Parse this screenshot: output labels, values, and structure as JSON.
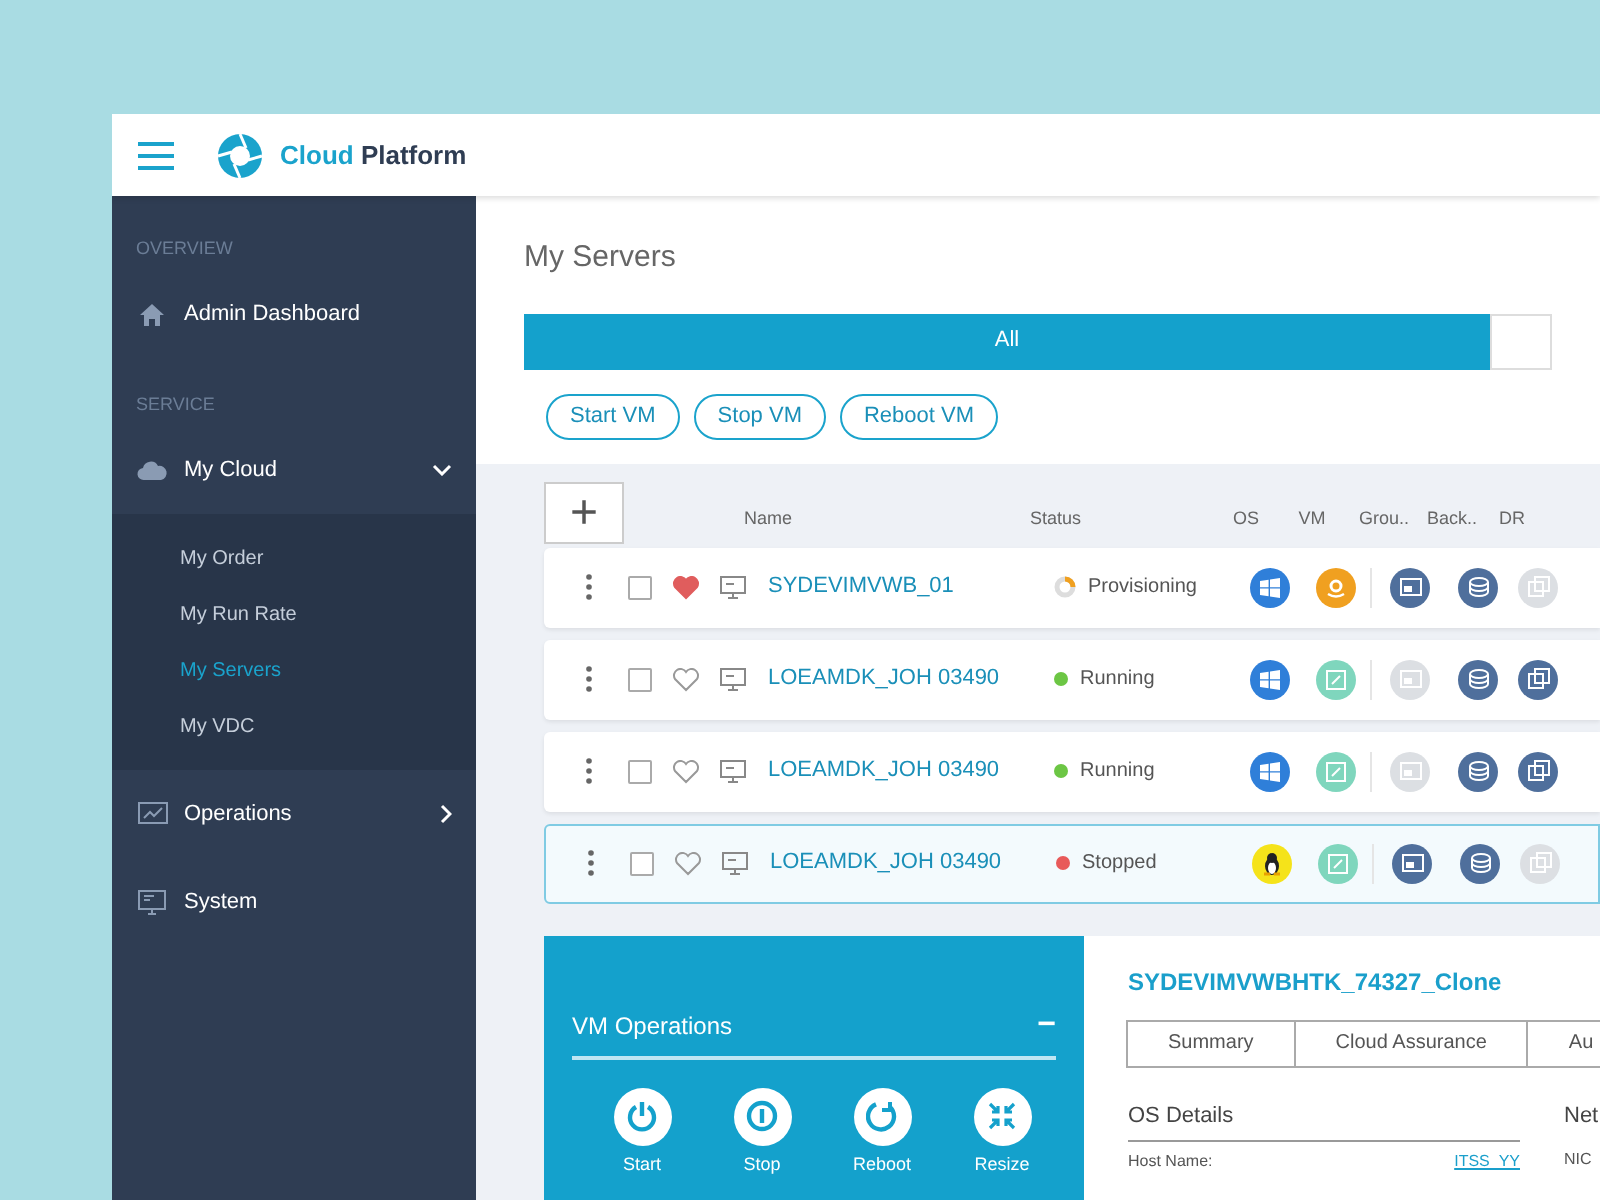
{
  "header": {
    "brand_first": "Cloud",
    "brand_second": "Platform"
  },
  "sidebar": {
    "sections": [
      {
        "heading": "OVERVIEW",
        "items": [
          {
            "label": "Admin Dashboard"
          }
        ]
      },
      {
        "heading": "SERVICE",
        "items": [
          {
            "label": "My Cloud",
            "expanded": true,
            "children": [
              {
                "label": "My Order",
                "selected": false
              },
              {
                "label": "My Run Rate",
                "selected": false
              },
              {
                "label": "My Servers",
                "selected": true
              },
              {
                "label": "My VDC",
                "selected": false
              }
            ]
          },
          {
            "label": "Operations",
            "expanded": false
          },
          {
            "label": "System"
          }
        ]
      }
    ]
  },
  "page": {
    "title": "My Servers"
  },
  "tabs": [
    {
      "label": "All",
      "selected": true
    }
  ],
  "actions": [
    "Start VM",
    "Stop VM",
    "Reboot VM"
  ],
  "table": {
    "add_symbol": "+",
    "columns": [
      "Name",
      "Status",
      "OS",
      "VM",
      "Grou..",
      "Back..",
      "DR"
    ],
    "rows": [
      {
        "name": "SYDEVIMVWB_01",
        "status": "Provisioning",
        "favorite": true,
        "selected": false,
        "os": {
          "kind": "windows"
        },
        "vm": {
          "kind": "amazon"
        },
        "group": true,
        "backup": true,
        "dr": false
      },
      {
        "name": "LOEAMDK_JOH 03490",
        "status": "Running",
        "color": "#6cc644",
        "favorite": false,
        "selected": false,
        "os": {
          "kind": "windows"
        },
        "vm": {
          "kind": "generic"
        },
        "group": false,
        "backup": true,
        "dr": true
      },
      {
        "name": "LOEAMDK_JOH 03490",
        "status": "Running",
        "color": "#6cc644",
        "favorite": false,
        "selected": false,
        "os": {
          "kind": "windows"
        },
        "vm": {
          "kind": "generic"
        },
        "group": false,
        "backup": true,
        "dr": true
      },
      {
        "name": "LOEAMDK_JOH 03490",
        "status": "Stopped",
        "color": "#e85a5a",
        "favorite": false,
        "selected": true,
        "os": {
          "kind": "linux"
        },
        "vm": {
          "kind": "generic"
        },
        "group": true,
        "backup": true,
        "dr": false
      }
    ]
  },
  "vm_operations": {
    "title": "VM Operations",
    "collapse_symbol": "−",
    "buttons": [
      {
        "label": "Start",
        "kind": "start"
      },
      {
        "label": "Stop",
        "kind": "stop"
      },
      {
        "label": "Reboot",
        "kind": "reboot"
      },
      {
        "label": "Resize",
        "kind": "resize"
      }
    ]
  },
  "details": {
    "title": "SYDEVIMVWBHTK_74327_Clone",
    "tabs": [
      {
        "label": "Summary",
        "selected": false
      },
      {
        "label": "Cloud Assurance",
        "selected": false
      },
      {
        "label": "Au",
        "selected": false
      }
    ],
    "os_heading": "OS Details",
    "net_heading": "Net",
    "fields": [
      {
        "label": "Host Name:",
        "value": "ITSS_YY"
      }
    ],
    "nic_label": "NIC"
  }
}
